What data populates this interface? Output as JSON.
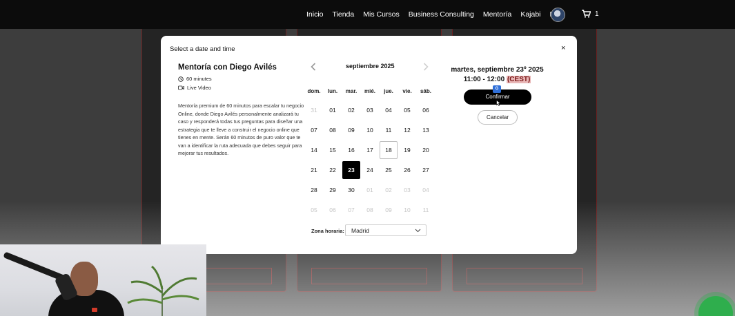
{
  "navbar": {
    "links": [
      "Inicio",
      "Tienda",
      "Mis Cursos",
      "Business Consulting",
      "Mentoría",
      "Kajabi",
      "Blog"
    ],
    "cart_count": "1"
  },
  "modal": {
    "title": "Select a date and time",
    "close_label": "×"
  },
  "event": {
    "title": "Mentoría con Diego Avilés",
    "duration": "60 minutes",
    "location": "Live Video",
    "description": "Mentoría premium de 60 minutos para escalar tu negocio Online, donde Diego Avilés personalmente analizará tu caso y responderá todas tus preguntas para diseñar una estrategia que te lleve a construir el negocio online que tienes en mente. Serán 60 minutos de puro valor que te van a identificar la ruta adecuada que debes seguir para mejorar tus resultados."
  },
  "calendar": {
    "month_label": "septiembre 2025",
    "weekdays": [
      "dom.",
      "lun.",
      "mar.",
      "mié.",
      "jue.",
      "vie.",
      "sáb."
    ],
    "weeks": [
      [
        {
          "d": "31",
          "m": true
        },
        {
          "d": "01"
        },
        {
          "d": "02"
        },
        {
          "d": "03"
        },
        {
          "d": "04"
        },
        {
          "d": "05"
        },
        {
          "d": "06"
        }
      ],
      [
        {
          "d": "07"
        },
        {
          "d": "08"
        },
        {
          "d": "09"
        },
        {
          "d": "10"
        },
        {
          "d": "11"
        },
        {
          "d": "12"
        },
        {
          "d": "13"
        }
      ],
      [
        {
          "d": "14"
        },
        {
          "d": "15"
        },
        {
          "d": "16"
        },
        {
          "d": "17"
        },
        {
          "d": "18",
          "today": true
        },
        {
          "d": "19"
        },
        {
          "d": "20"
        }
      ],
      [
        {
          "d": "21"
        },
        {
          "d": "22"
        },
        {
          "d": "23",
          "sel": true
        },
        {
          "d": "24"
        },
        {
          "d": "25"
        },
        {
          "d": "26"
        },
        {
          "d": "27"
        }
      ],
      [
        {
          "d": "28"
        },
        {
          "d": "29"
        },
        {
          "d": "30"
        },
        {
          "d": "01",
          "m": true
        },
        {
          "d": "02",
          "m": true
        },
        {
          "d": "03",
          "m": true
        },
        {
          "d": "04",
          "m": true
        }
      ],
      [
        {
          "d": "05",
          "m": true
        },
        {
          "d": "06",
          "m": true
        },
        {
          "d": "07",
          "m": true
        },
        {
          "d": "08",
          "m": true
        },
        {
          "d": "09",
          "m": true
        },
        {
          "d": "10",
          "m": true
        },
        {
          "d": "11",
          "m": true
        }
      ]
    ],
    "timezone_label": "Zona horaria:",
    "timezone_value": "Madrid"
  },
  "selection": {
    "date": "martes, septiembre 23º 2025",
    "time": "11:00 - 12:00",
    "tz": "(CEST)",
    "confirm_label": "Confirmar",
    "cancel_label": "Cancelar"
  },
  "colors": {
    "selected_day": "#000000",
    "tz_highlight": "#e9b7b7",
    "navbar": "#0c0c0c"
  }
}
